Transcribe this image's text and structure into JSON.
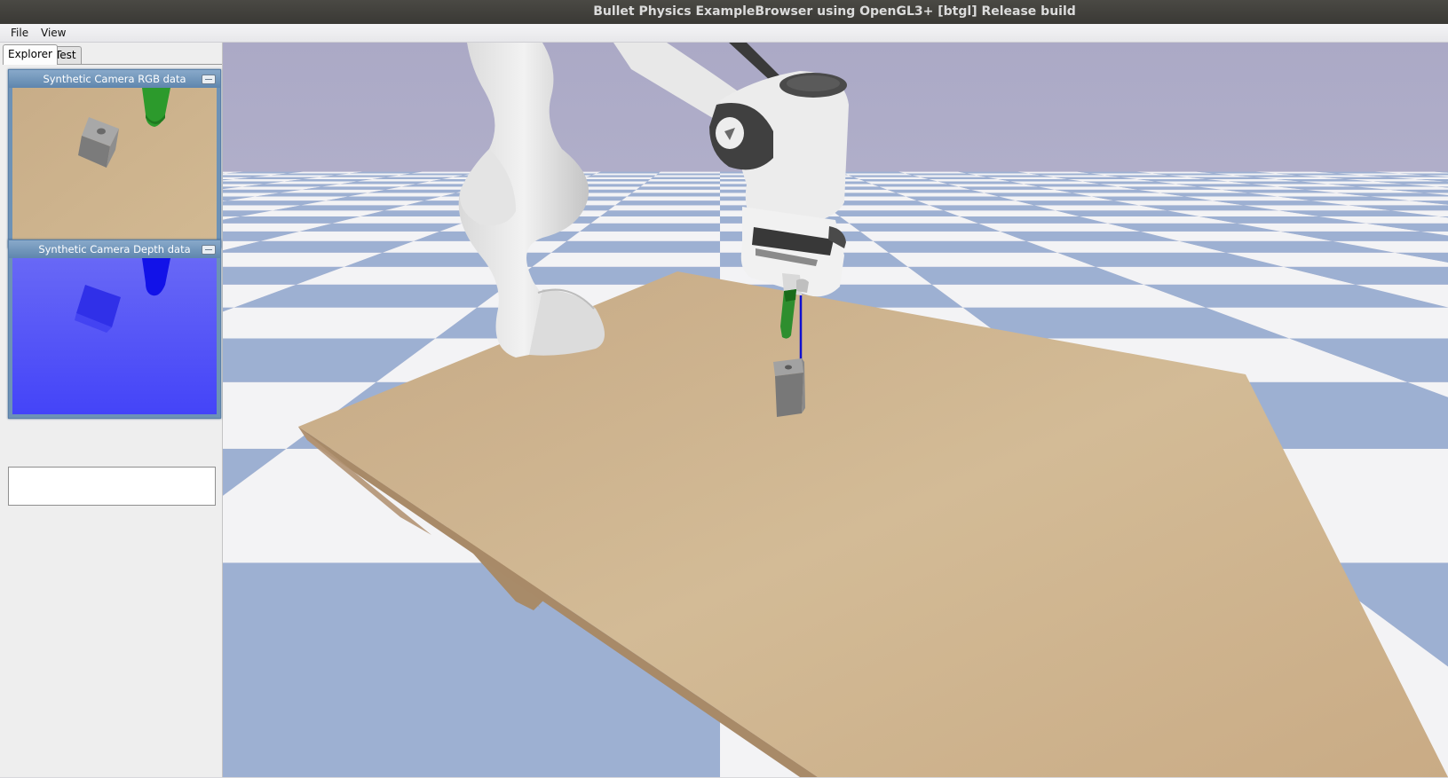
{
  "window": {
    "title": "Bullet Physics ExampleBrowser using OpenGL3+ [btgl] Release build"
  },
  "menu": {
    "file": "File",
    "view": "View"
  },
  "tabs": {
    "explorer": "Explorer",
    "test": "Test"
  },
  "camera_panels": {
    "rgb_title": "Synthetic Camera RGB data",
    "depth_title": "Synthetic Camera Depth data"
  },
  "colors": {
    "sky": "#b7b6cf",
    "floor_blue": "#9db0d2",
    "floor_white": "#f3f3f5",
    "table": "#c9ab84",
    "gripper_finger": "#2f8f2f",
    "depth_bg": "#5c5cf5",
    "panel_header": "#6d92b6"
  },
  "icons": [
    "minimize-icon",
    "minimize-icon"
  ]
}
